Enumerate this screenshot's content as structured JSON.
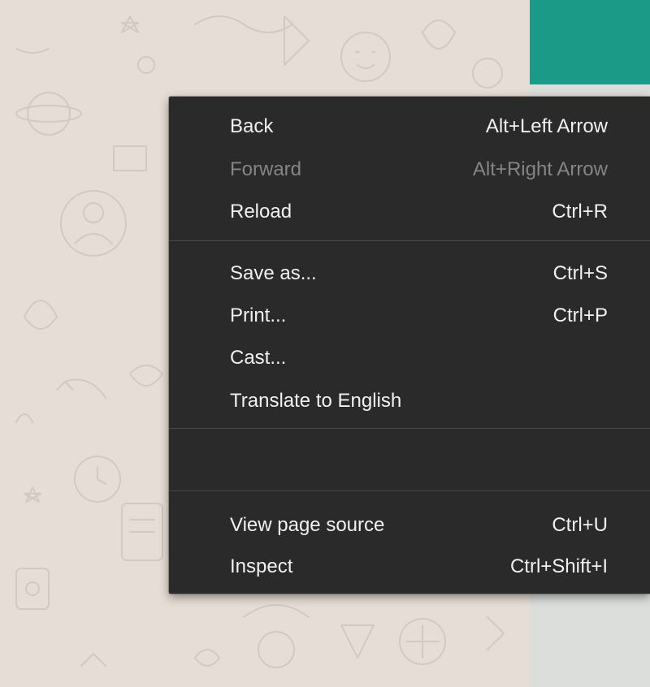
{
  "context_menu": {
    "items": [
      {
        "label": "Back",
        "shortcut": "Alt+Left Arrow",
        "enabled": true
      },
      {
        "label": "Forward",
        "shortcut": "Alt+Right Arrow",
        "enabled": false
      },
      {
        "label": "Reload",
        "shortcut": "Ctrl+R",
        "enabled": true
      },
      {
        "label": "Save as...",
        "shortcut": "Ctrl+S",
        "enabled": true
      },
      {
        "label": "Print...",
        "shortcut": "Ctrl+P",
        "enabled": true
      },
      {
        "label": "Cast...",
        "shortcut": "",
        "enabled": true
      },
      {
        "label": "Translate to English",
        "shortcut": "",
        "enabled": true
      },
      {
        "label": "View page source",
        "shortcut": "Ctrl+U",
        "enabled": true
      },
      {
        "label": "Inspect",
        "shortcut": "Ctrl+Shift+I",
        "enabled": true
      }
    ]
  },
  "colors": {
    "menu_background": "#2a2a2b",
    "menu_text": "#f1f1f1",
    "menu_text_disabled": "#858585",
    "chat_background": "#e6ded6",
    "banner": "#1b9a88",
    "side_panel": "#dcdedb"
  }
}
